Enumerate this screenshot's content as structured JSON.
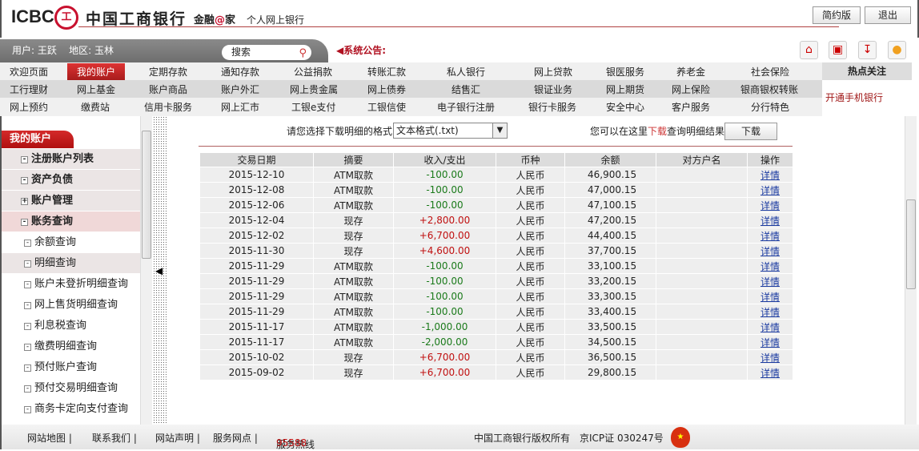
{
  "header": {
    "logo_en": "ICBC",
    "logo_seal": "工",
    "logo_cn": "中国工商银行",
    "slogan_a": "金融",
    "slogan_at": "@",
    "slogan_b": "家",
    "subtitle": "个人网上银行",
    "simple_btn": "简约版",
    "logout_btn": "退出"
  },
  "userbar": {
    "user_label": "用户:",
    "user": "王跃",
    "region_label": "地区:",
    "region": "玉林",
    "search_placeholder": "搜索",
    "notice": "系统公告:"
  },
  "nav": [
    [
      "欢迎页面",
      "我的账户",
      "定期存款",
      "通知存款",
      "公益捐款",
      "转账汇款",
      "私人银行",
      "网上贷款",
      "银医服务",
      "养老金",
      "社会保险"
    ],
    [
      "工行理财",
      "网上基金",
      "账户商品",
      "账户外汇",
      "网上贵金属",
      "网上债券",
      "结售汇",
      "银证业务",
      "网上期货",
      "网上保险",
      "银商银权转账"
    ],
    [
      "网上预约",
      "缴费站",
      "信用卡服务",
      "网上汇市",
      "工银e支付",
      "工银信使",
      "电子银行注册",
      "银行卡服务",
      "安全中心",
      "客户服务",
      "分行特色"
    ]
  ],
  "hot": {
    "title": "热点关注",
    "link": "开通手机银行"
  },
  "sidebar": {
    "tab": "我的账户",
    "items": [
      {
        "label": "注册账户列表",
        "level": 1,
        "box": "-"
      },
      {
        "label": "资产负债",
        "level": 1,
        "box": "-"
      },
      {
        "label": "账户管理",
        "level": 1,
        "box": "+"
      },
      {
        "label": "账务查询",
        "level": 1,
        "box": "-",
        "sel": true
      },
      {
        "label": "余额查询",
        "level": 2,
        "box": "-"
      },
      {
        "label": "明细查询",
        "level": 2,
        "box": "-",
        "sel": true
      },
      {
        "label": "账户未登折明细查询",
        "level": 2,
        "box": "-"
      },
      {
        "label": "网上售货明细查询",
        "level": 2,
        "box": "-"
      },
      {
        "label": "利息税查询",
        "level": 2,
        "box": "-"
      },
      {
        "label": "缴费明细查询",
        "level": 2,
        "box": "-"
      },
      {
        "label": "预付账户查询",
        "level": 2,
        "box": "-"
      },
      {
        "label": "预付交易明细查询",
        "level": 2,
        "box": "-"
      },
      {
        "label": "商务卡定向支付查询",
        "level": 2,
        "box": "-"
      }
    ]
  },
  "main": {
    "format_label": "请您选择下载明细的格式",
    "format_value": "文本格式(.txt)",
    "dl_pre": "您可以在这里",
    "dl_link": "下载",
    "dl_post": "查询明细结果",
    "dl_btn": "下载",
    "columns": [
      "交易日期",
      "摘要",
      "收入/支出",
      "币种",
      "余额",
      "对方户名",
      "操作"
    ],
    "rows": [
      [
        "2015-12-10",
        "ATM取款",
        "-100.00",
        "人民币",
        "46,900.15",
        "",
        "详情"
      ],
      [
        "2015-12-08",
        "ATM取款",
        "-100.00",
        "人民币",
        "47,000.15",
        "",
        "详情"
      ],
      [
        "2015-12-06",
        "ATM取款",
        "-100.00",
        "人民币",
        "47,100.15",
        "",
        "详情"
      ],
      [
        "2015-12-04",
        "现存",
        "+2,800.00",
        "人民币",
        "47,200.15",
        "",
        "详情"
      ],
      [
        "2015-12-02",
        "现存",
        "+6,700.00",
        "人民币",
        "44,400.15",
        "",
        "详情"
      ],
      [
        "2015-11-30",
        "现存",
        "+4,600.00",
        "人民币",
        "37,700.15",
        "",
        "详情"
      ],
      [
        "2015-11-29",
        "ATM取款",
        "-100.00",
        "人民币",
        "33,100.15",
        "",
        "详情"
      ],
      [
        "2015-11-29",
        "ATM取款",
        "-100.00",
        "人民币",
        "33,200.15",
        "",
        "详情"
      ],
      [
        "2015-11-29",
        "ATM取款",
        "-100.00",
        "人民币",
        "33,300.15",
        "",
        "详情"
      ],
      [
        "2015-11-29",
        "ATM取款",
        "-100.00",
        "人民币",
        "33,400.15",
        "",
        "详情"
      ],
      [
        "2015-11-17",
        "ATM取款",
        "-1,000.00",
        "人民币",
        "33,500.15",
        "",
        "详情"
      ],
      [
        "2015-11-17",
        "ATM取款",
        "-2,000.00",
        "人民币",
        "34,500.15",
        "",
        "详情"
      ],
      [
        "2015-10-02",
        "现存",
        "+6,700.00",
        "人民币",
        "36,500.15",
        "",
        "详情"
      ],
      [
        "2015-09-02",
        "现存",
        "+6,700.00",
        "人民币",
        "29,800.15",
        "",
        "详情"
      ]
    ]
  },
  "footer": {
    "links": [
      "网站地图 |",
      "联系我们 |",
      "网站声明 |",
      "服务网点 |"
    ],
    "hotline_label": "服务热线",
    "hotline": "95588",
    "copyright": "中国工商银行版权所有",
    "icp": "京ICP证 030247号"
  },
  "colors": {
    "brand": "#c8102e",
    "income": "#c01010",
    "expense": "#1a7a1a"
  }
}
